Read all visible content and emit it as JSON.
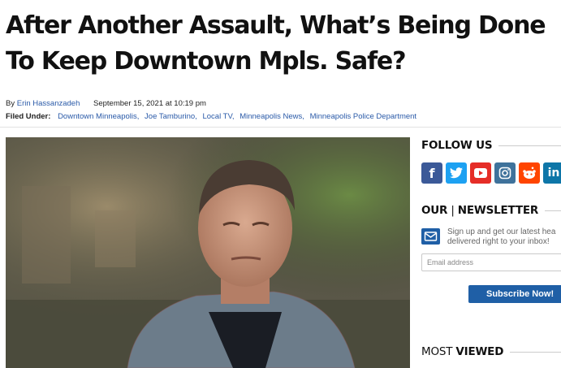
{
  "article": {
    "title": "After Another Assault, What’s Being Done To Keep Downtown Mpls. Safe?",
    "by_label": "By",
    "author": "Erin Hassanzadeh",
    "date": "September 15, 2021 at 10:19 pm",
    "filed_label": "Filed Under:",
    "tags": [
      "Downtown Minneapolis,",
      "Joe Tamburino,",
      "Local TV,",
      "Minneapolis News,",
      "Minneapolis Police Department"
    ]
  },
  "sidebar": {
    "follow": {
      "title": "FOLLOW US"
    },
    "social": [
      {
        "name": "facebook-icon",
        "glyph": "f",
        "color": "#3b5998"
      },
      {
        "name": "twitter-icon",
        "glyph": "",
        "color": "#1da1f2"
      },
      {
        "name": "youtube-icon",
        "glyph": "",
        "color": "#e52d27"
      },
      {
        "name": "instagram-icon",
        "glyph": "",
        "color": "#3f729b"
      },
      {
        "name": "reddit-icon",
        "glyph": "",
        "color": "#ff4500"
      },
      {
        "name": "linkedin-icon",
        "glyph": "in",
        "color": "#0e76a8"
      }
    ],
    "newsletter": {
      "title_a": "OUR",
      "title_sep": "|",
      "title_b": "NEWSLETTER",
      "line1": "Sign up and get our latest hea",
      "line2": "delivered right to your inbox!",
      "placeholder": "Email address",
      "button": "Subscribe Now!"
    },
    "most_viewed": {
      "title_a": "MOST",
      "title_b": "VIEWED"
    }
  },
  "colors": {
    "link": "#2a5aa8",
    "accent": "#1f5fa6"
  }
}
